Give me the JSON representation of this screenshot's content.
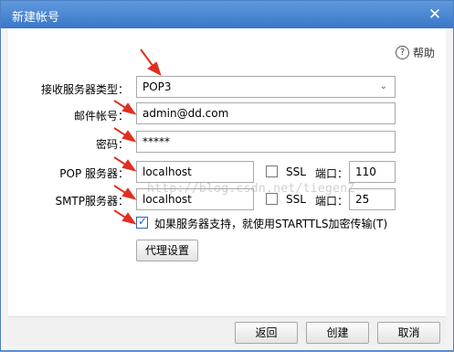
{
  "window": {
    "title": "新建帐号"
  },
  "help": {
    "label": "帮助"
  },
  "form": {
    "receive_server_type": {
      "label": "接收服务器类型：",
      "value": "POP3"
    },
    "email_account": {
      "label": "邮件帐号：",
      "value": "admin@dd.com"
    },
    "password": {
      "label": "密码：",
      "value": "*****"
    },
    "pop_server": {
      "label": "POP 服务器：",
      "value": "localhost",
      "ssl_label": "SSL",
      "port_label": "端口：",
      "port": "110"
    },
    "smtp_server": {
      "label": "SMTP服务器：",
      "value": "localhost",
      "ssl_label": "SSL",
      "port_label": "端口：",
      "port": "25"
    },
    "starttls": {
      "label": "如果服务器支持，就使用STARTTLS加密传输(T)"
    },
    "proxy_button": "代理设置"
  },
  "footer": {
    "back": "返回",
    "create": "创建",
    "cancel": "取消"
  },
  "watermark": "http://blog.csdn.net/tiegenZ",
  "colors": {
    "title_bar": "#3a76c8",
    "arrow": "#e03020",
    "check": "#1f5fbf"
  }
}
